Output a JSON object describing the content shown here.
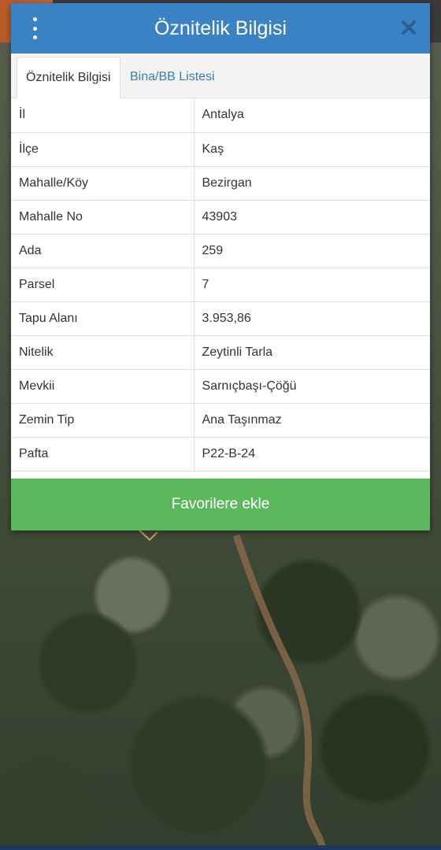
{
  "dialog": {
    "title": "Öznitelik Bilgisi",
    "menu_icon": "vertical-dots-icon",
    "close_icon": "close-x-icon"
  },
  "tabs": [
    {
      "label": "Öznitelik Bilgisi",
      "active": true
    },
    {
      "label": "Bina/BB Listesi",
      "active": false
    }
  ],
  "attributes": [
    {
      "key": "İl",
      "value": "Antalya"
    },
    {
      "key": "İlçe",
      "value": "Kaş"
    },
    {
      "key": "Mahalle/Köy",
      "value": "Bezirgan"
    },
    {
      "key": "Mahalle No",
      "value": "43903"
    },
    {
      "key": "Ada",
      "value": "259"
    },
    {
      "key": "Parsel",
      "value": "7"
    },
    {
      "key": "Tapu Alanı",
      "value": "3.953,86"
    },
    {
      "key": "Nitelik",
      "value": "Zeytinli Tarla"
    },
    {
      "key": "Mevkii",
      "value": "Sarnıçbaşı-Çöğü"
    },
    {
      "key": "Zemin Tip",
      "value": "Ana Taşınmaz"
    },
    {
      "key": "Pafta",
      "value": "P22-B-24"
    }
  ],
  "footer": {
    "favorite_label": "Favorilere ekle"
  },
  "colors": {
    "header": "#3a82c4",
    "button": "#5cb85c",
    "tab_link": "#2e7fbf"
  }
}
